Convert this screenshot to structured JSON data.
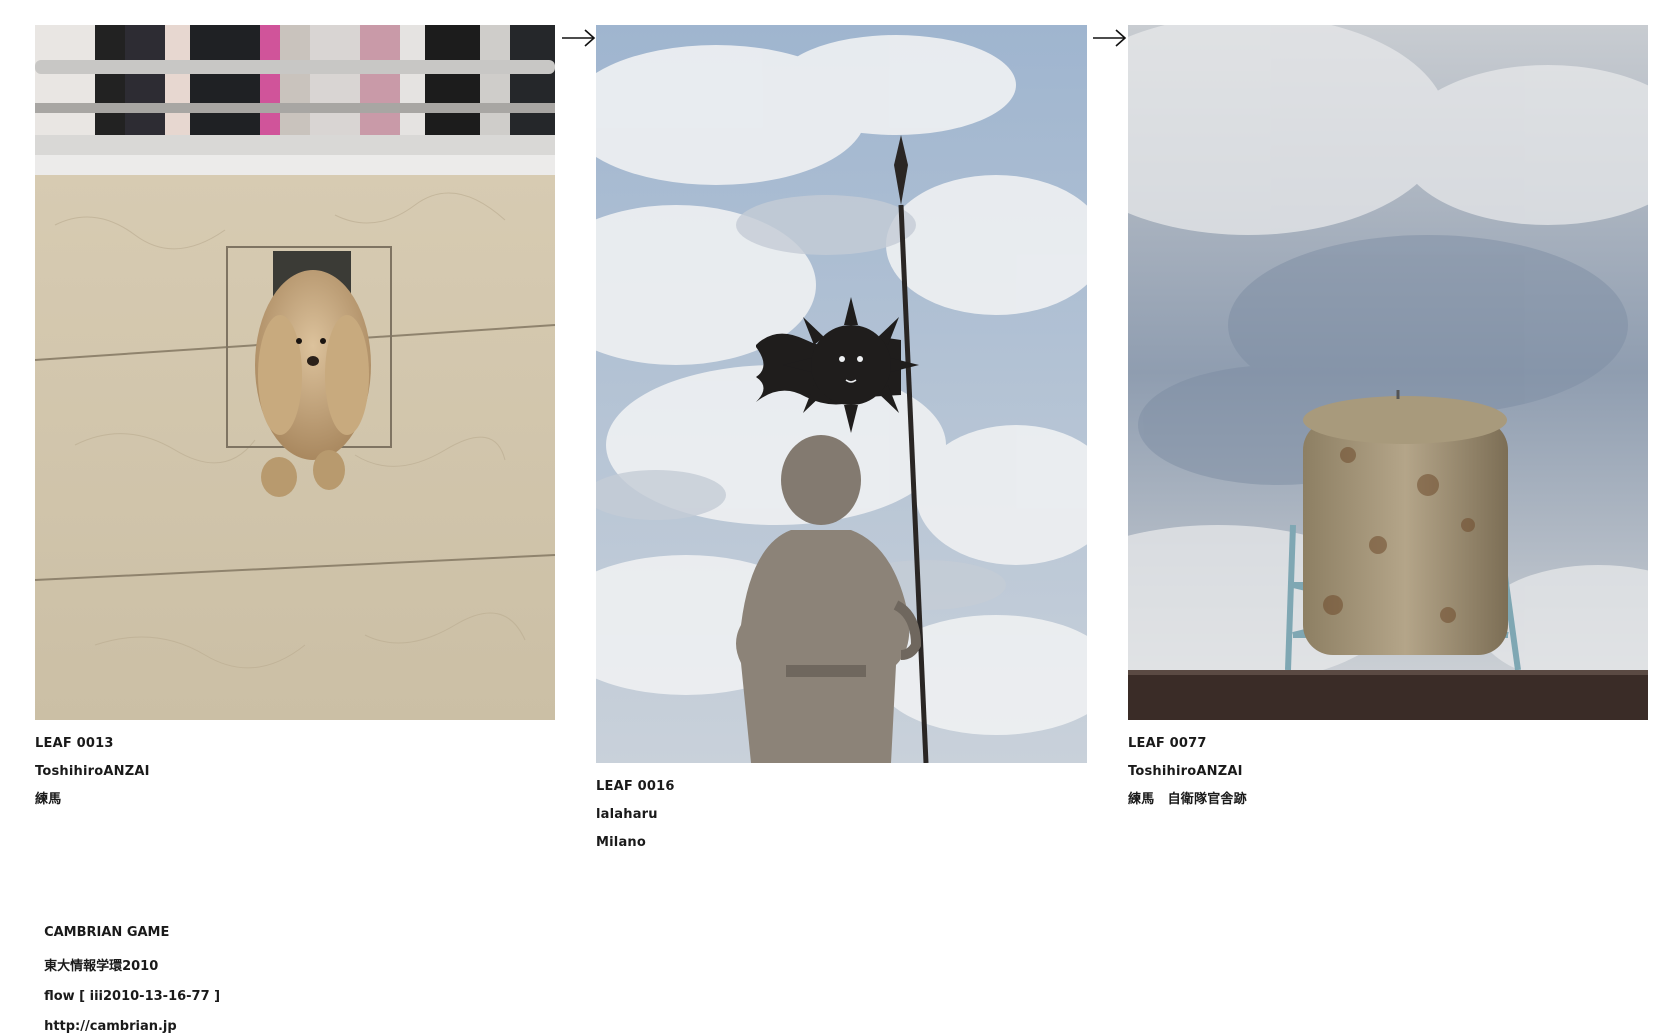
{
  "leaves": [
    {
      "id_label": "LEAF 0013",
      "author": "ToshihiroANZAI",
      "location": "練馬",
      "image_subject": "cocker-spaniel-in-wall-window"
    },
    {
      "id_label": "LEAF 0016",
      "author": "lalaharu",
      "location": "Milano",
      "image_subject": "statue-with-spear-and-sun-flag"
    },
    {
      "id_label": "LEAF 0077",
      "author": "ToshihiroANZAI",
      "location": "練馬　自衛隊官舎跡",
      "image_subject": "rusty-water-tower"
    }
  ],
  "arrows": [
    "flow-arrow-icon",
    "flow-arrow-icon"
  ],
  "footer": {
    "brand": "CAMBRIAN GAME",
    "event": "東大情報学環2010",
    "flow": "flow [ iii2010-13-16-77 ]",
    "url": "http://cambrian.jp"
  },
  "colors": {
    "text": "#1a1a1a",
    "background": "#ffffff"
  }
}
